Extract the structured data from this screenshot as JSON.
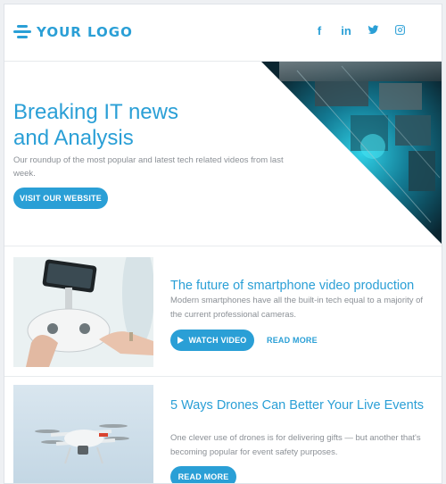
{
  "header": {
    "logo_text": "YOUR LOGO",
    "social": [
      {
        "icon": "facebook-icon",
        "glyph": "f"
      },
      {
        "icon": "linkedin-icon",
        "glyph": "in"
      },
      {
        "icon": "twitter-icon",
        "glyph": ""
      },
      {
        "icon": "instagram-icon",
        "glyph": ""
      }
    ]
  },
  "hero": {
    "title_line1": "Breaking IT news",
    "title_line2": "and Analysis",
    "description": "Our roundup of the most popular and latest tech related videos from last week.",
    "button_label": "VISIT OUR WEBSITE"
  },
  "articles": [
    {
      "title": "The future of smartphone video production",
      "description": "Modern smartphones have all the built-in tech equal to a majority of the current professional cameras.",
      "primary_label": "WATCH VIDEO",
      "secondary_label": "READ MORE"
    },
    {
      "title": "5 Ways Drones Can Better Your Live Events",
      "description": "One clever use of drones is for delivering gifts — but another that's becoming popular for event safety purposes.",
      "primary_label": "READ MORE"
    }
  ],
  "colors": {
    "accent": "#2a9fd6",
    "muted_text": "#8b9096",
    "background": "#ffffff"
  }
}
